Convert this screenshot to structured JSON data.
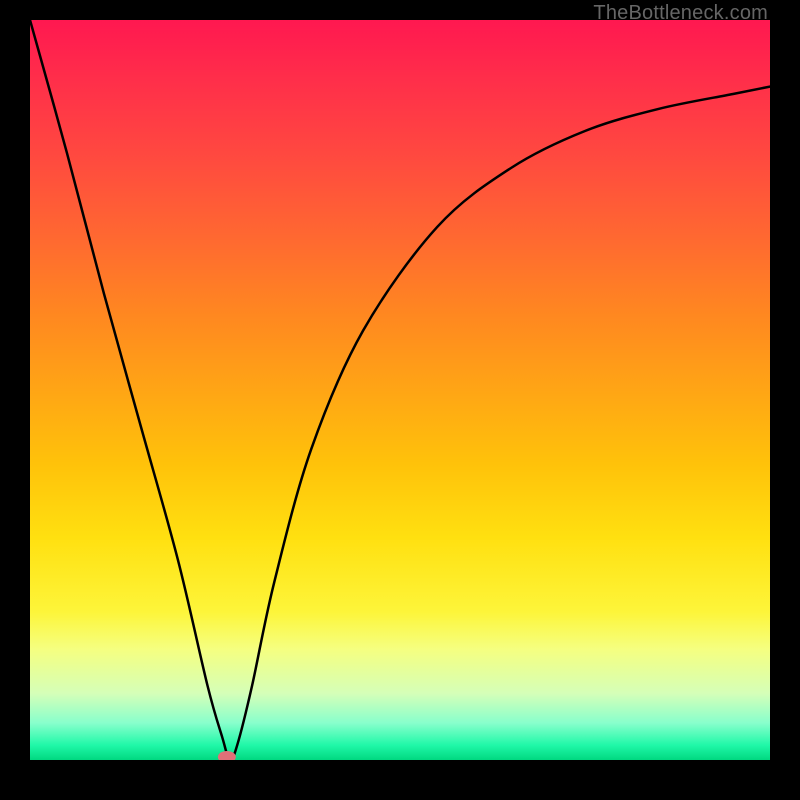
{
  "watermark": "TheBottleneck.com",
  "chart_data": {
    "type": "line",
    "title": "",
    "xlabel": "",
    "ylabel": "",
    "xlim": [
      0,
      100
    ],
    "ylim": [
      0,
      100
    ],
    "grid": false,
    "series": [
      {
        "name": "bottleneck-curve",
        "x": [
          0,
          5,
          10,
          15,
          20,
          24,
          26,
          27,
          28,
          30,
          33,
          38,
          45,
          55,
          65,
          75,
          85,
          95,
          100
        ],
        "y": [
          100,
          82,
          63,
          45,
          27,
          10,
          3,
          0,
          2,
          10,
          24,
          42,
          58,
          72,
          80,
          85,
          88,
          90,
          91
        ]
      }
    ],
    "marker": {
      "x": 26.6,
      "y": 0
    }
  }
}
